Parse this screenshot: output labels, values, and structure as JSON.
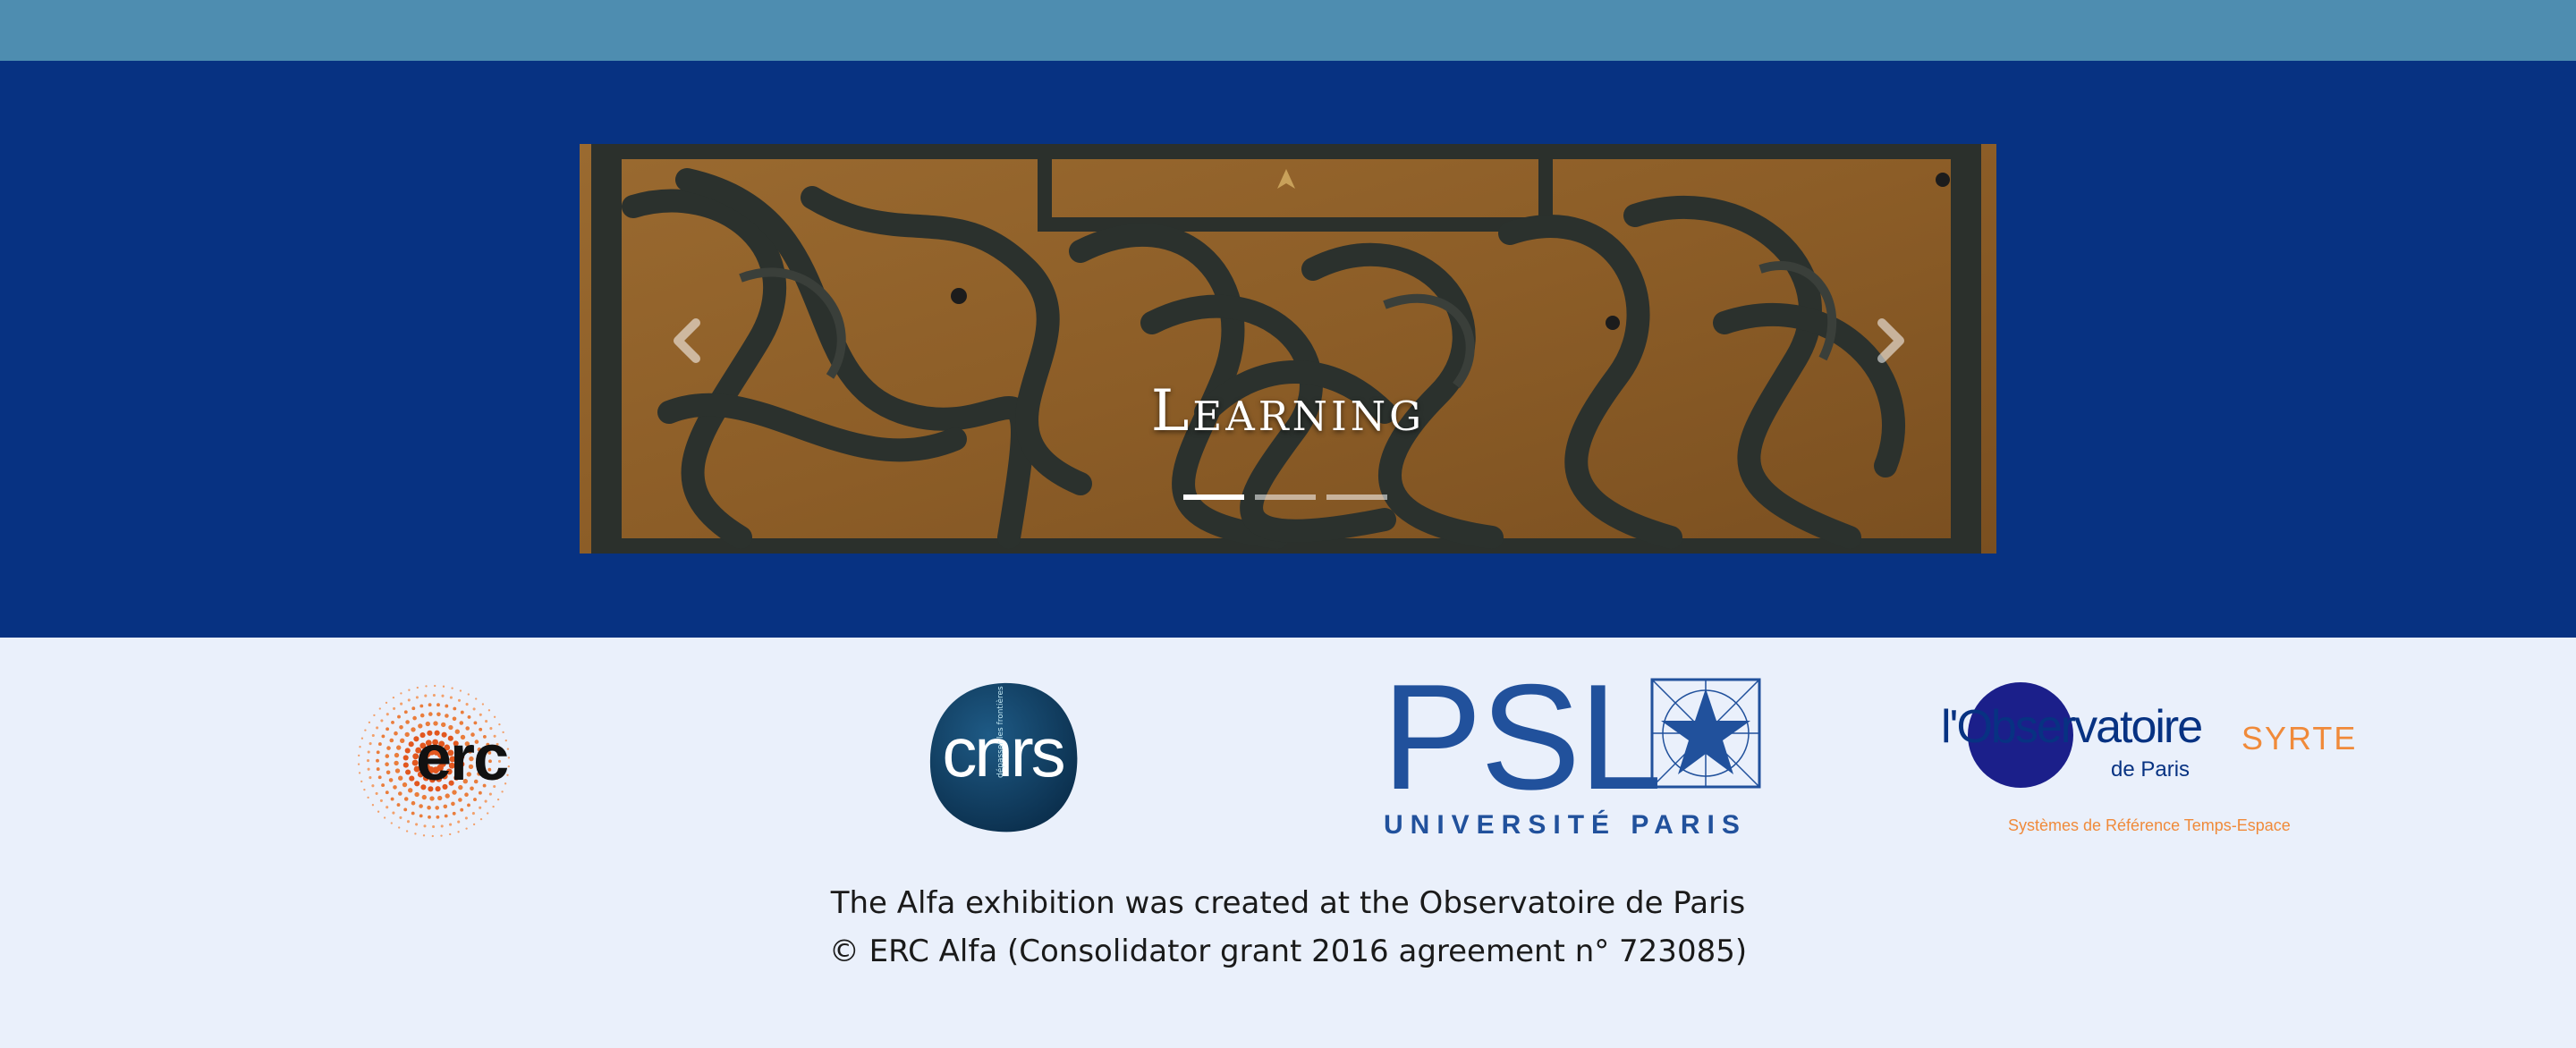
{
  "carousel": {
    "slides": [
      {
        "caption": "Learning"
      },
      {
        "caption": ""
      },
      {
        "caption": ""
      }
    ],
    "active_index": 0,
    "prev_icon": "chevron-left-icon",
    "next_icon": "chevron-right-icon"
  },
  "partners": {
    "erc": {
      "text": "erc"
    },
    "cnrs": {
      "text": "cnrs",
      "tagline": "dépasser les frontières"
    },
    "psl": {
      "word": "PSL",
      "subtitle": "UNIVERSITÉ PARIS"
    },
    "observatoire": {
      "name": "l'Observatoire",
      "sub": "de Paris",
      "syrte": "SYRTE",
      "tagline": "Systèmes de Référence Temps-Espace"
    }
  },
  "footer": {
    "line1": "The Alfa exhibition was created at the Observatoire de Paris",
    "line2": "© ERC Alfa (Consolidator grant 2016 agreement n° 723085)"
  },
  "colors": {
    "top_bar": "#4e8db0",
    "hero_bg": "#073282",
    "footer_bg": "#eaf0fb",
    "psl_blue": "#21519c",
    "syrte_orange": "#f08a3a"
  }
}
